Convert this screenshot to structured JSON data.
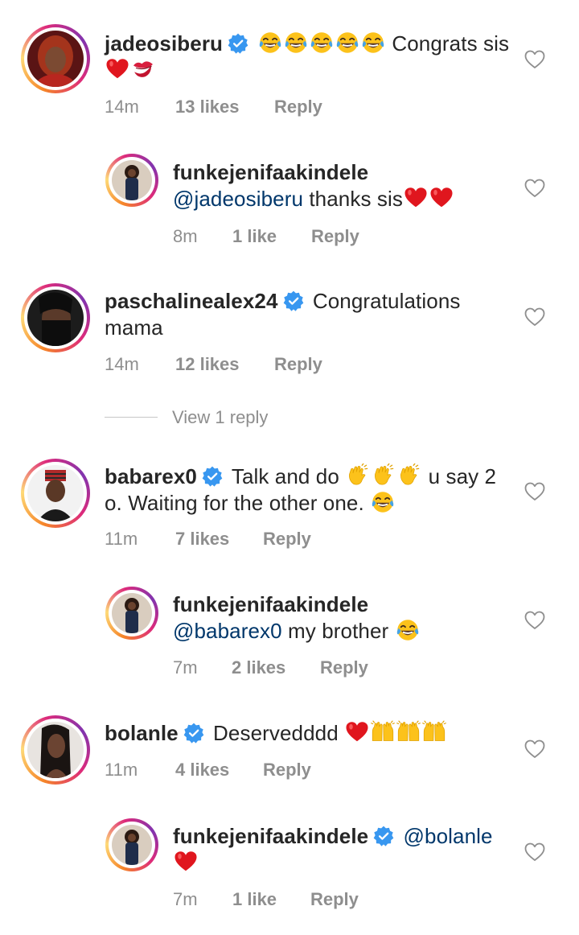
{
  "comments": [
    {
      "username": "jadeosiberu",
      "verified": true,
      "text_before": "",
      "text": " Congrats sis ",
      "time": "14m",
      "likes": "13 likes",
      "reply": "Reply"
    },
    {
      "username": "funkejenifaakindele",
      "mention": "@jadeosiberu",
      "text": " thanks sis",
      "time": "8m",
      "likes": "1 like",
      "reply": "Reply"
    },
    {
      "username": "paschalinealex24",
      "verified": true,
      "text": "Congratulations mama",
      "time": "14m",
      "likes": "12 likes",
      "reply": "Reply"
    },
    {
      "username": "babarex0",
      "verified": true,
      "text_a": "Talk and do ",
      "text_b": " u say 2 o. Waiting for the other one. ",
      "time": "11m",
      "likes": "7 likes",
      "reply": "Reply"
    },
    {
      "username": "funkejenifaakindele",
      "mention": "@babarex0",
      "text": " my brother ",
      "time": "7m",
      "likes": "2 likes",
      "reply": "Reply"
    },
    {
      "username": "bolanle",
      "verified": true,
      "text": "Deservedddd ",
      "time": "11m",
      "likes": "4 likes",
      "reply": "Reply"
    },
    {
      "username": "funkejenifaakindele",
      "verified": true,
      "mention": "@bolanle",
      "time": "7m",
      "likes": "1 like",
      "reply": "Reply"
    }
  ],
  "view_replies": "View 1 reply",
  "colors": {
    "verified": "#3897f0",
    "mention": "#00376b",
    "meta": "#8e8e8e",
    "red_heart": "#e0161e"
  },
  "icons": [
    "verified-badge-icon",
    "laughing-emoji-icon",
    "red-heart-emoji-icon",
    "kiss-mark-emoji-icon",
    "clapping-hands-emoji-icon",
    "raising-hands-emoji-icon",
    "like-heart-outline-icon"
  ]
}
